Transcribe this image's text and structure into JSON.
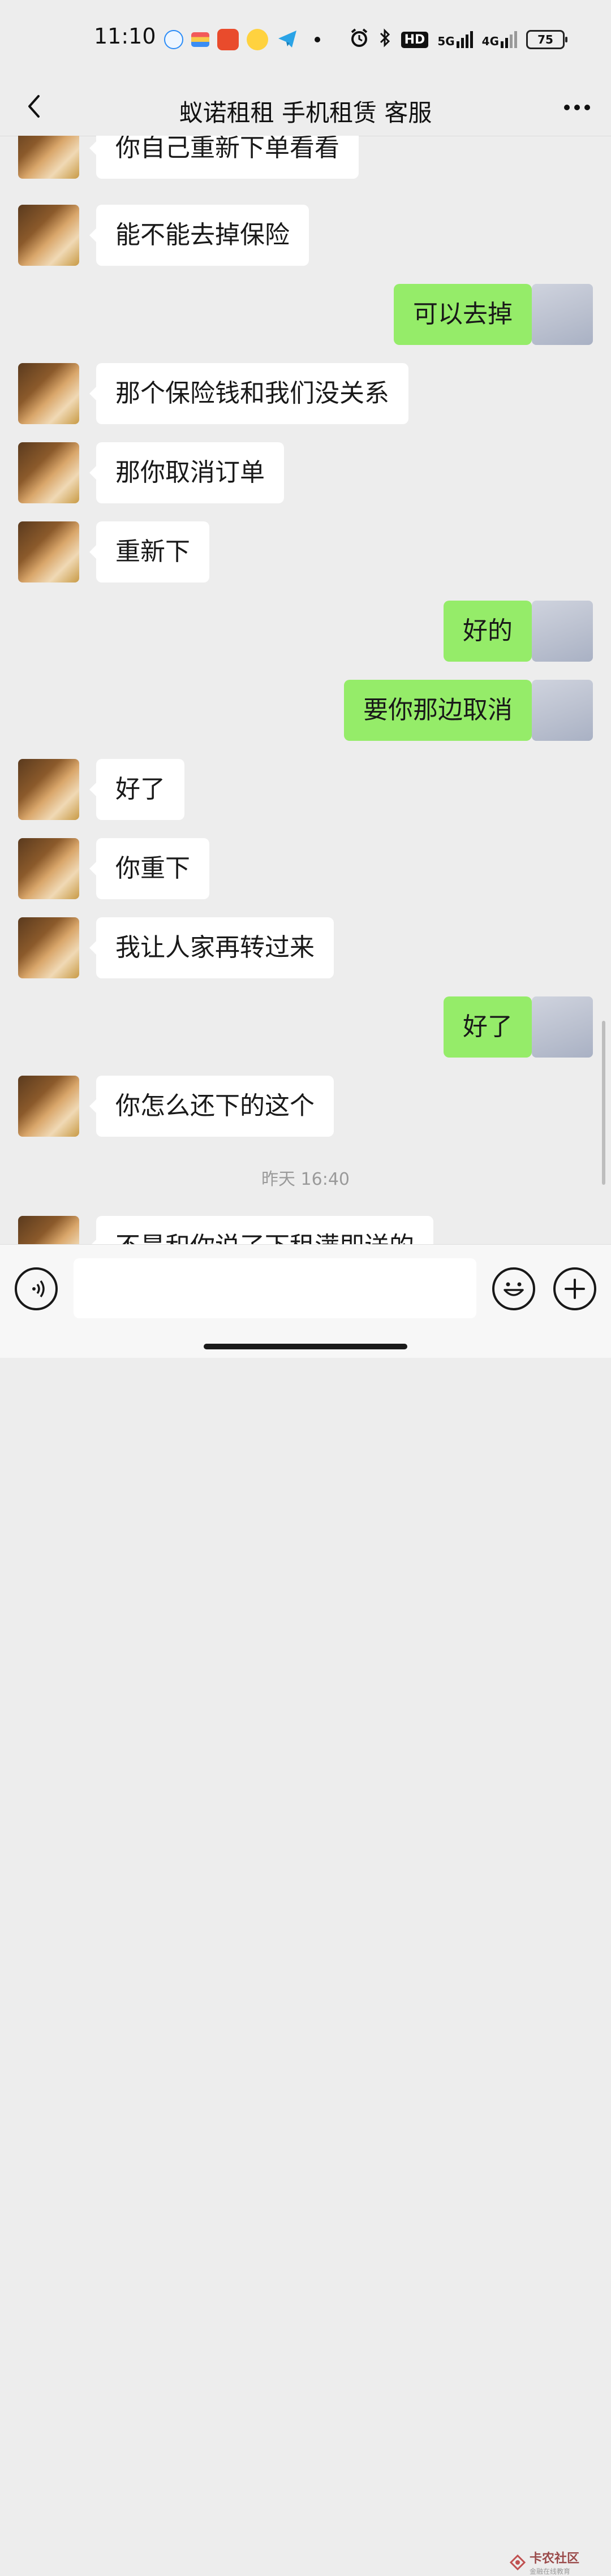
{
  "status_bar": {
    "time": "11:10",
    "battery": "75",
    "network_5g": "5G",
    "network_4g": "4G",
    "hd": "HD"
  },
  "header": {
    "title": "蚁诺租租 手机租赁 客服"
  },
  "messages": [
    {
      "side": "left",
      "text": "你自己重新下单看看"
    },
    {
      "side": "left",
      "text": "能不能去掉保险"
    },
    {
      "side": "right",
      "text": "可以去掉"
    },
    {
      "side": "left",
      "text": "那个保险钱和我们没关系"
    },
    {
      "side": "left",
      "text": "那你取消订单"
    },
    {
      "side": "left",
      "text": "重新下"
    },
    {
      "side": "right",
      "text": "好的"
    },
    {
      "side": "right",
      "text": "要你那边取消"
    },
    {
      "side": "left",
      "text": "好了"
    },
    {
      "side": "left",
      "text": "你重下"
    },
    {
      "side": "left",
      "text": "我让人家再转过来"
    },
    {
      "side": "right",
      "text": "好了"
    },
    {
      "side": "left",
      "text": "你怎么还下的这个"
    },
    {
      "side": "left",
      "text": "不是和你说了下租满即送的"
    }
  ],
  "timestamp": "昨天 16:40",
  "watermark": {
    "main": "卡农社区",
    "sub": "金融在线教育"
  },
  "colors": {
    "background": "#ededed",
    "bubble_self": "#95ec69",
    "bubble_other": "#ffffff"
  }
}
